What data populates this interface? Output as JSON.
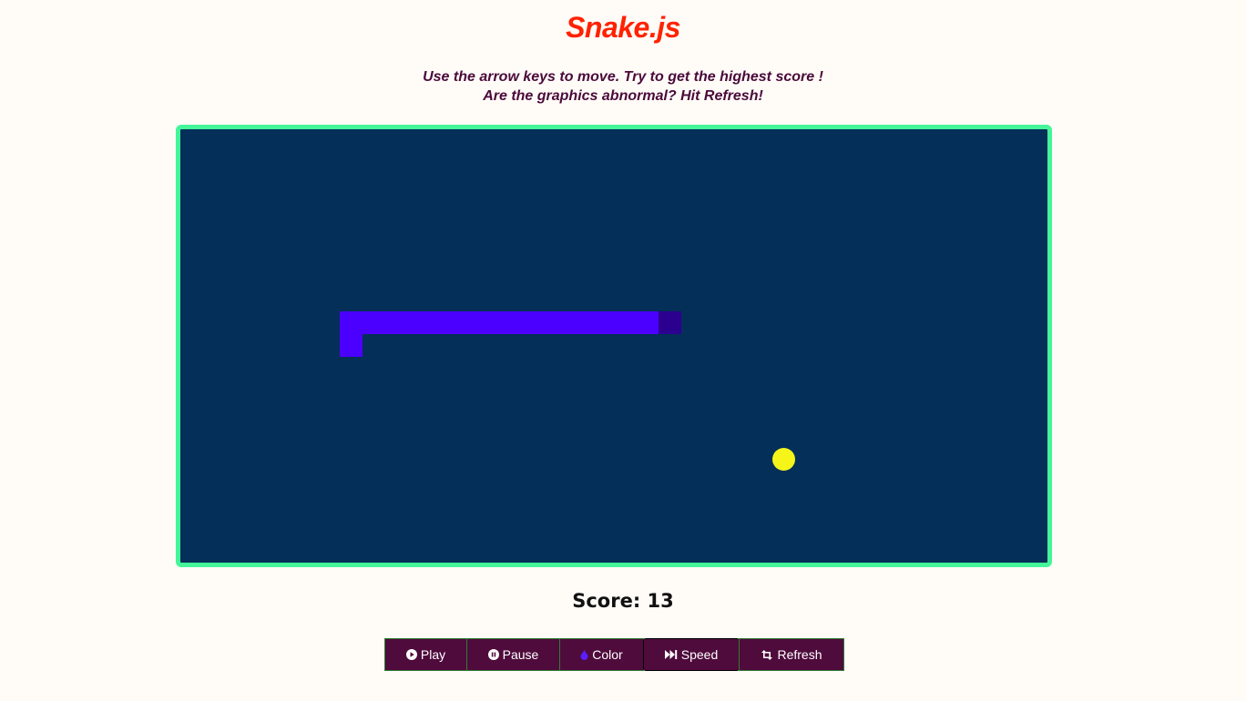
{
  "header": {
    "title": "Snake.js",
    "instructions_line1": "Use the arrow keys to move. Try to get the highest score !",
    "instructions_line2": "Are the graphics abnormal? Hit Refresh!"
  },
  "game": {
    "board_color": "#042f59",
    "border_color": "#44f59a",
    "snake_color": "#4b00ff",
    "snake_head_color": "#2b008f",
    "food_color": "#f5f51a"
  },
  "score": {
    "text": "Score: 13",
    "value": 13
  },
  "controls": {
    "play_label": "Play",
    "pause_label": "Pause",
    "color_label": "Color",
    "speed_label": "Speed",
    "refresh_label": "Refresh",
    "play_icon": "play-circle-icon",
    "pause_icon": "pause-circle-icon",
    "color_icon": "droplet-icon",
    "speed_icon": "fast-forward-icon",
    "refresh_icon": "retweet-icon",
    "button_color": "#4f0b3c"
  }
}
